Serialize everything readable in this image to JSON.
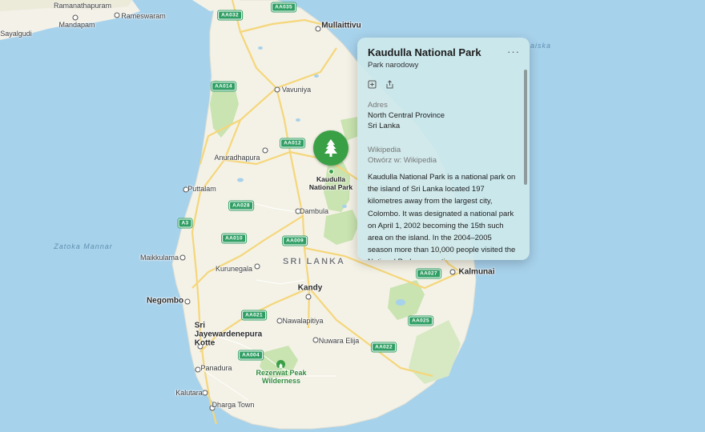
{
  "map": {
    "country_label": "SRI LANKA",
    "water_labels": [
      "Zatoka Mannar",
      "aiska"
    ],
    "cities": [
      {
        "name": "Ramanathapuram",
        "kind": "town"
      },
      {
        "name": "Rameswaram",
        "kind": "town"
      },
      {
        "name": "Mandapam",
        "kind": "town"
      },
      {
        "name": "Sayalgudi",
        "kind": "town"
      },
      {
        "name": "Mullaittivu",
        "kind": "city"
      },
      {
        "name": "Vavuniya",
        "kind": "town"
      },
      {
        "name": "Anuradhapura",
        "kind": "town"
      },
      {
        "name": "Puttalam",
        "kind": "town"
      },
      {
        "name": "Dambula",
        "kind": "town"
      },
      {
        "name": "Maikkulama",
        "kind": "town"
      },
      {
        "name": "Kurunegala",
        "kind": "town"
      },
      {
        "name": "Kandy",
        "kind": "city"
      },
      {
        "name": "Negombo",
        "kind": "city"
      },
      {
        "name": "Sri\nJayewardenepura\nKotte",
        "kind": "city"
      },
      {
        "name": "Nawalapitiya",
        "kind": "town"
      },
      {
        "name": "Nuwara Elija",
        "kind": "town"
      },
      {
        "name": "Panadura",
        "kind": "town"
      },
      {
        "name": "Kalutara",
        "kind": "town"
      },
      {
        "name": "Dharga Town",
        "kind": "town"
      },
      {
        "name": "Kalmunai",
        "kind": "city"
      }
    ],
    "parks": [
      {
        "name": "Rezerwat Peak\nWilderness"
      }
    ],
    "road_shields": [
      "AA032",
      "AA035",
      "AA014",
      "AA012",
      "AA028",
      "A3",
      "AA010",
      "AA009",
      "AA027",
      "AA021",
      "AA025",
      "AA022",
      "AA004"
    ],
    "selected_poi": {
      "name": "Kaudulla\nNational Park",
      "icon": "tree-icon",
      "color": "#3aa046"
    }
  },
  "panel": {
    "title": "Kaudulla National Park",
    "subtitle": "Park narodowy",
    "more_label": "···",
    "actions": [
      {
        "icon": "add-to-guide-icon"
      },
      {
        "icon": "share-icon"
      }
    ],
    "address_label": "Adres",
    "address_lines": [
      "North Central Province",
      "Sri Lanka"
    ],
    "wikipedia_label": "Wikipedia",
    "wikipedia_link": "Otwórz w: Wikipedia",
    "description": "Kaudulla National Park is a national park on the island of Sri Lanka located 197 kilometres away from the largest city, Colombo. It was designated a national park on April 1, 2002 becoming the 15th such area on the island. In the 2004–2005 season more than 10,000 people visited the National Park, generating an"
  }
}
